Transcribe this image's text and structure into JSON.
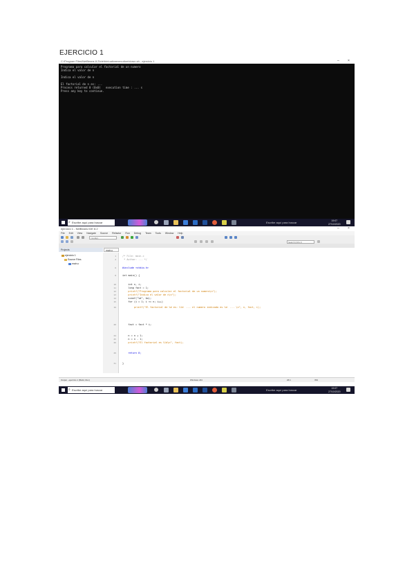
{
  "document": {
    "heading": "EJERCICIO 1"
  },
  "console_window": {
    "title": "C:\\Program Files\\NetBeans 8.2\\ide\\bin\\nativeexecution\\dorun.sh - ejercicio 1",
    "lines": [
      "Programa para calcular el factorial de un numero",
      "Indica el valor de n",
      "",
      "Indica el valor de n",
      "",
      "El factorial de n es: ...",
      "Process returned 0 (0x0)   execution time : ... s",
      "Press any key to continue."
    ],
    "minimize": "–",
    "close": "×"
  },
  "taskbar": {
    "search_placeholder": "Escribe aquí para buscar",
    "tray_text": "Escribe aquí para buscar",
    "time": "19:07",
    "date": "27/10/2020"
  },
  "ide": {
    "title": "ejercicio 1 - NetBeans IDE 8.2",
    "menus": [
      "File",
      "Edit",
      "View",
      "Navigate",
      "Source",
      "Refactor",
      "Run",
      "Debug",
      "Team",
      "Tools",
      "Window",
      "Help"
    ],
    "config_field": "<config>",
    "search_field": "Search (Ctrl+I)",
    "projects_tab": "Projects",
    "tree": [
      {
        "label": "ejercicio 1",
        "color": "#d09a2b"
      },
      {
        "label": "Source Files",
        "color": "#e0b34a"
      },
      {
        "label": "main.c",
        "color": "#4f7fd6"
      }
    ],
    "editor_tab": "main.c",
    "code": [
      {
        "ln": "1",
        "kind": "com",
        "text": "/* File: main.c"
      },
      {
        "ln": "2",
        "kind": "com",
        "text": " * Author: ... */"
      },
      {
        "ln": "6",
        "kind": "kw",
        "text": "#include <stdio.h>"
      },
      {
        "ln": "8",
        "kind": "txt",
        "text": "int main() {"
      },
      {
        "ln": "10",
        "kind": "txt",
        "text": "    int n, i;"
      },
      {
        "ln": "11",
        "kind": "txt",
        "text": "    long fact = 1;"
      },
      {
        "ln": "12",
        "kind": "str",
        "text": "    printf(\"Programa para calcular el factorial de un numero\\n\");"
      },
      {
        "ln": "13",
        "kind": "str",
        "text": "    printf(\"Indica el valor de n\\n\");"
      },
      {
        "ln": "14",
        "kind": "txt",
        "text": "    scanf(\"%d\", &n);"
      },
      {
        "ln": "15",
        "kind": "txt",
        "text": "    for (i = 1; i <= n; i++)"
      },
      {
        "ln": "16",
        "kind": "str",
        "text": "        printf(\"El factorial de %d es: %ld  ... el numero indicado es %d  ... \\n\", n, fact, i);"
      },
      {
        "ln": "20",
        "kind": "txt",
        "text": "    fact = fact * i;"
      },
      {
        "ln": "24",
        "kind": "txt",
        "text": "    n = n + 1;"
      },
      {
        "ln": "25",
        "kind": "txt",
        "text": "    n = n - 1;"
      },
      {
        "ln": "26",
        "kind": "str",
        "text": "    printf(\"El factorial es %ld\\n\", fact);"
      },
      {
        "ln": "29",
        "kind": "kw",
        "text": "    return 0;"
      },
      {
        "ln": "31",
        "kind": "txt",
        "text": "}"
      }
    ],
    "status_left": "Output - ejercicio 1 (Build, Run)",
    "status_mid": "Windows x64",
    "status_pos": "26:1",
    "status_ins": "INS"
  },
  "colors": {
    "console_bg": "#0c0c0c",
    "taskbar_bg": "#15152a",
    "keyword": "#0000e6",
    "string": "#ce7b00",
    "comment": "#969696"
  }
}
